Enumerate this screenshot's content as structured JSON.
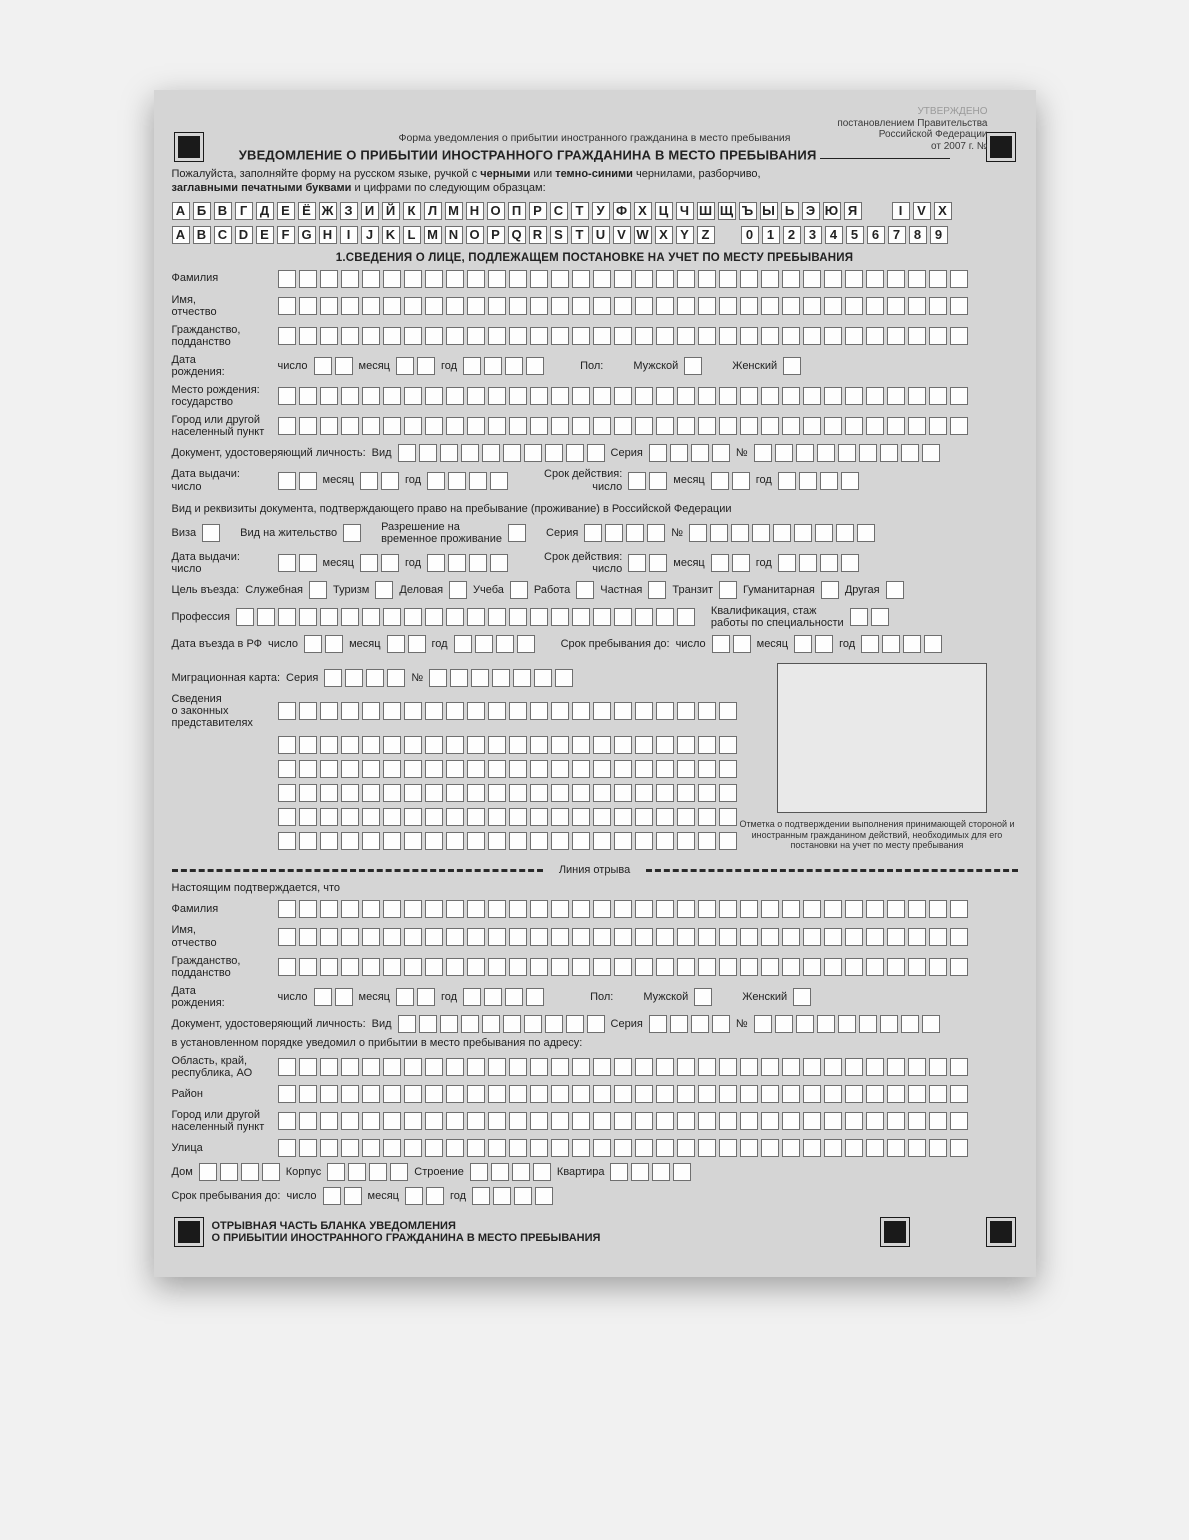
{
  "header": {
    "approved_by": "УТВЕРЖДЕНО",
    "decree_l1": "постановлением Правительства",
    "decree_l2": "Российской Федерации",
    "decree_prefix": "от ",
    "decree_year": "2007 г.",
    "decree_num_label": " №",
    "form_kind": "Форма уведомления о прибытии иностранного гражданина в место пребывания",
    "title": "УВЕДОМЛЕНИЕ О ПРИБЫТИИ ИНОСТРАННОГО ГРАЖДАНИНА В МЕСТО ПРЕБЫВАНИЯ "
  },
  "instructions": {
    "p1": "Пожалуйста, заполняйте форму на русском языке, ручкой с ",
    "b1": "черными",
    "p2": " или ",
    "b2": "темно-синими",
    "p3": " чернилами, разборчиво,",
    "b3": "заглавными печатными буквами",
    "p4": " и цифрами по следующим образцам:"
  },
  "samples": {
    "cyr": [
      "А",
      "Б",
      "В",
      "Г",
      "Д",
      "Е",
      "Ё",
      "Ж",
      "З",
      "И",
      "Й",
      "К",
      "Л",
      "М",
      "Н",
      "О",
      "П",
      "Р",
      "С",
      "Т",
      "У",
      "Ф",
      "Х",
      "Ц",
      "Ч",
      "Ш",
      "Щ",
      "Ъ",
      "Ы",
      "Ь",
      "Э",
      "Ю",
      "Я"
    ],
    "roman": [
      "I",
      "V",
      "X"
    ],
    "lat": [
      "A",
      "B",
      "C",
      "D",
      "E",
      "F",
      "G",
      "H",
      "I",
      "J",
      "K",
      "L",
      "M",
      "N",
      "O",
      "P",
      "Q",
      "R",
      "S",
      "T",
      "U",
      "V",
      "W",
      "X",
      "Y",
      "Z"
    ],
    "digits": [
      "0",
      "1",
      "2",
      "3",
      "4",
      "5",
      "6",
      "7",
      "8",
      "9"
    ]
  },
  "common": {
    "dob_l1": "Дата",
    "dob_l2": "рождения:",
    "day": "число",
    "month": "месяц",
    "year": "год",
    "sex": "Пол:",
    "male": "Мужской",
    "female": "Женский",
    "kind": "Вид",
    "series": "Серия",
    "number": "№",
    "issue_l1": "Дата выдачи:",
    "valid_l1": "Срок действия:"
  },
  "section1": {
    "heading": "1.СВЕДЕНИЯ О ЛИЦЕ, ПОДЛЕЖАЩЕМ ПОСТАНОВКЕ НА УЧЕТ ПО МЕСТУ ПРЕБЫВАНИЯ",
    "surname": "Фамилия",
    "name_patr": "Имя,\nотчество",
    "citizenship": "Гражданство,\nподданство",
    "birth_country": "Место рождения:\nгосударство",
    "birth_city": "Город или другой\nнаселенный пункт",
    "id_doc": "Документ, удостоверяющий личность:",
    "stay_doc_heading": "Вид и реквизиты документа, подтверждающего право на пребывание (проживание) в Российской Федерации",
    "visa": "Виза",
    "residence_permit": "Вид на жительство",
    "temp_residence": "Разрешение на\nвременное проживание",
    "purpose": "Цель въезда:",
    "purposes": [
      "Служебная",
      "Туризм",
      "Деловая",
      "Учеба",
      "Работа",
      "Частная",
      "Транзит",
      "Гуманитарная",
      "Другая"
    ],
    "profession": "Профессия",
    "qualification": "Квалификация, стаж\nработы по специальности",
    "entry_date": "Дата въезда в РФ",
    "stay_until": "Срок пребывания до:",
    "migration_card": "Миграционная карта:",
    "legal_reps": "Сведения\nо законных\nпредставителях",
    "stamp_caption": "Отметка о подтверждении выполнения принимающей стороной и иностранным гражданином действий, необходимых для его постановки на учет по месту пребывания"
  },
  "tear": {
    "label": "Линия отрыва"
  },
  "section2": {
    "confirms": "Настоящим подтверждается, что",
    "notified_line": "в установленном порядке уведомил о прибытии в место пребывания по адресу:",
    "region": "Область, край,\nреспублика, АО",
    "district": "Район",
    "street": "Улица",
    "house": "Дом",
    "block": "Корпус",
    "building": "Строение",
    "flat": "Квартира"
  },
  "footer": {
    "l1": "ОТРЫВНАЯ ЧАСТЬ БЛАНКА УВЕДОМЛЕНИЯ",
    "l2": "О ПРИБЫТИИ ИНОСТРАННОГО ГРАЖДАНИНА В МЕСТО ПРЕБЫВАНИЯ"
  }
}
